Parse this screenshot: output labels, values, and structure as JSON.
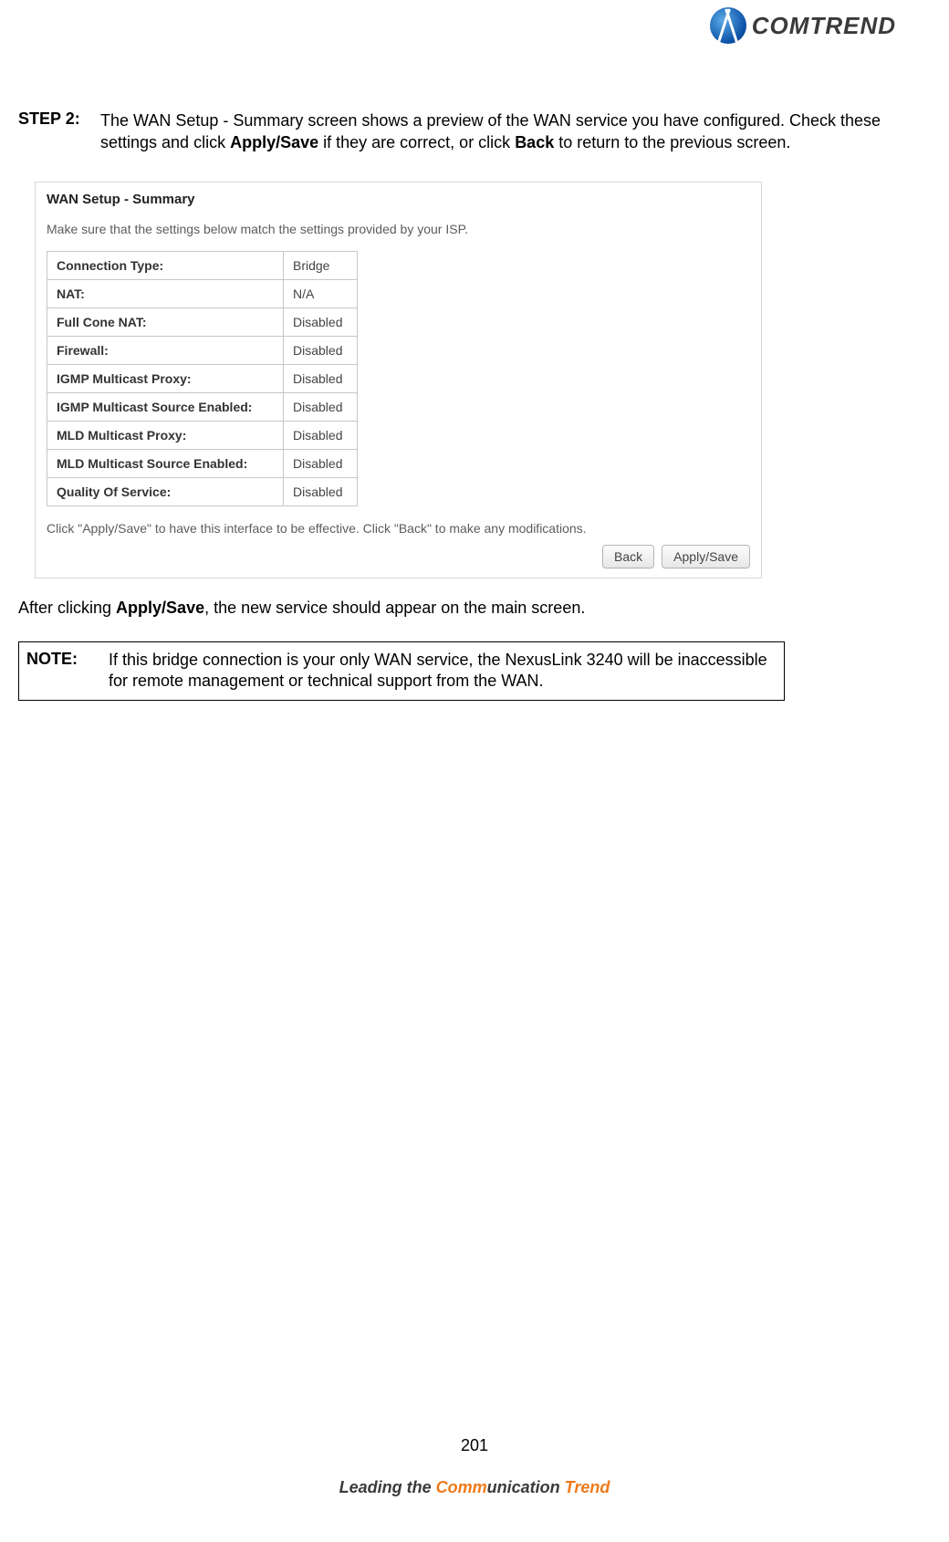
{
  "brand": {
    "name": "COMTREND"
  },
  "step": {
    "label": "STEP 2:",
    "text_before_apply": "The WAN Setup - Summary screen shows a preview of the WAN service you have configured. Check these settings and click ",
    "apply": "Apply/Save",
    "text_mid": " if they are correct, or click ",
    "back": "Back",
    "text_after": " to return to the previous screen."
  },
  "panel": {
    "title": "WAN Setup - Summary",
    "subtitle": "Make sure that the settings below match the settings provided by your ISP.",
    "rows": [
      {
        "k": "Connection Type:",
        "v": "Bridge"
      },
      {
        "k": "NAT:",
        "v": "N/A"
      },
      {
        "k": "Full Cone NAT:",
        "v": "Disabled"
      },
      {
        "k": "Firewall:",
        "v": "Disabled"
      },
      {
        "k": "IGMP Multicast Proxy:",
        "v": "Disabled"
      },
      {
        "k": "IGMP Multicast Source Enabled:",
        "v": "Disabled"
      },
      {
        "k": "MLD Multicast Proxy:",
        "v": "Disabled"
      },
      {
        "k": "MLD Multicast Source Enabled:",
        "v": "Disabled"
      },
      {
        "k": "Quality Of Service:",
        "v": "Disabled"
      }
    ],
    "footer_text": "Click \"Apply/Save\" to have this interface to be effective. Click \"Back\" to make any modifications.",
    "buttons": {
      "back": "Back",
      "apply": "Apply/Save"
    }
  },
  "after": {
    "before": "After clicking ",
    "apply": "Apply/Save",
    "after": ", the new service should appear on the main screen."
  },
  "note": {
    "label": "NOTE:",
    "text": "If this bridge connection is your only WAN service, the NexusLink 3240 will be inaccessible for remote management or technical support from the WAN."
  },
  "page_number": "201",
  "tagline": {
    "lead": "Leading the ",
    "comm": "Comm",
    "unication": "unication ",
    "trend": "Trend"
  }
}
